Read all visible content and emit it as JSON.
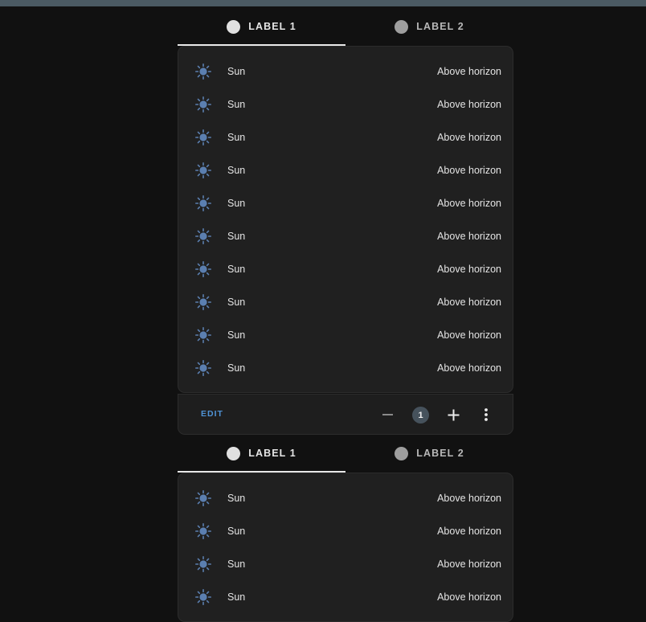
{
  "tabs": [
    {
      "label": "LABEL 1",
      "active": true
    },
    {
      "label": "LABEL 2",
      "active": false
    }
  ],
  "cards": [
    {
      "rows": [
        {
          "name": "Sun",
          "state": "Above horizon"
        },
        {
          "name": "Sun",
          "state": "Above horizon"
        },
        {
          "name": "Sun",
          "state": "Above horizon"
        },
        {
          "name": "Sun",
          "state": "Above horizon"
        },
        {
          "name": "Sun",
          "state": "Above horizon"
        },
        {
          "name": "Sun",
          "state": "Above horizon"
        },
        {
          "name": "Sun",
          "state": "Above horizon"
        },
        {
          "name": "Sun",
          "state": "Above horizon"
        },
        {
          "name": "Sun",
          "state": "Above horizon"
        },
        {
          "name": "Sun",
          "state": "Above horizon"
        }
      ],
      "footer": {
        "edit_label": "EDIT",
        "count": "1"
      }
    },
    {
      "rows": [
        {
          "name": "Sun",
          "state": "Above horizon"
        },
        {
          "name": "Sun",
          "state": "Above horizon"
        },
        {
          "name": "Sun",
          "state": "Above horizon"
        },
        {
          "name": "Sun",
          "state": "Above horizon"
        }
      ]
    }
  ],
  "icons": {
    "row_icon": "sun-icon",
    "minus": "minus-icon",
    "plus": "plus-icon",
    "more": "more-vertical-icon"
  },
  "colors": {
    "background": "#111111",
    "card": "#202020",
    "sun_icon": "#5b7fb0",
    "edit_accent": "#4f93d6",
    "badge": "#46525c",
    "topbar": "#4b5a63"
  }
}
